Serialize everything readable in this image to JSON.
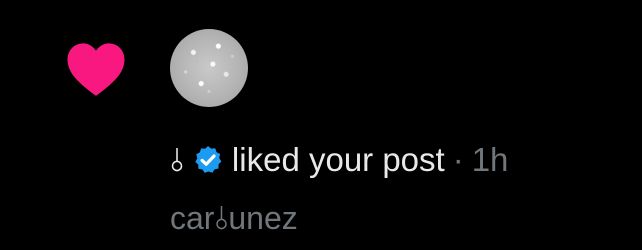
{
  "notification": {
    "display_name": "⫰",
    "action_text": "liked your post",
    "separator": "·",
    "timestamp": "1h",
    "username": "car⫰unez",
    "verified": true
  },
  "icons": {
    "type_icon": "heart-icon",
    "verified_icon": "verified-badge-icon"
  },
  "colors": {
    "background": "#000000",
    "heart": "#f91880",
    "verified": "#1d9bf0",
    "primary_text": "#e7e9ea",
    "secondary_text": "#71767b"
  }
}
